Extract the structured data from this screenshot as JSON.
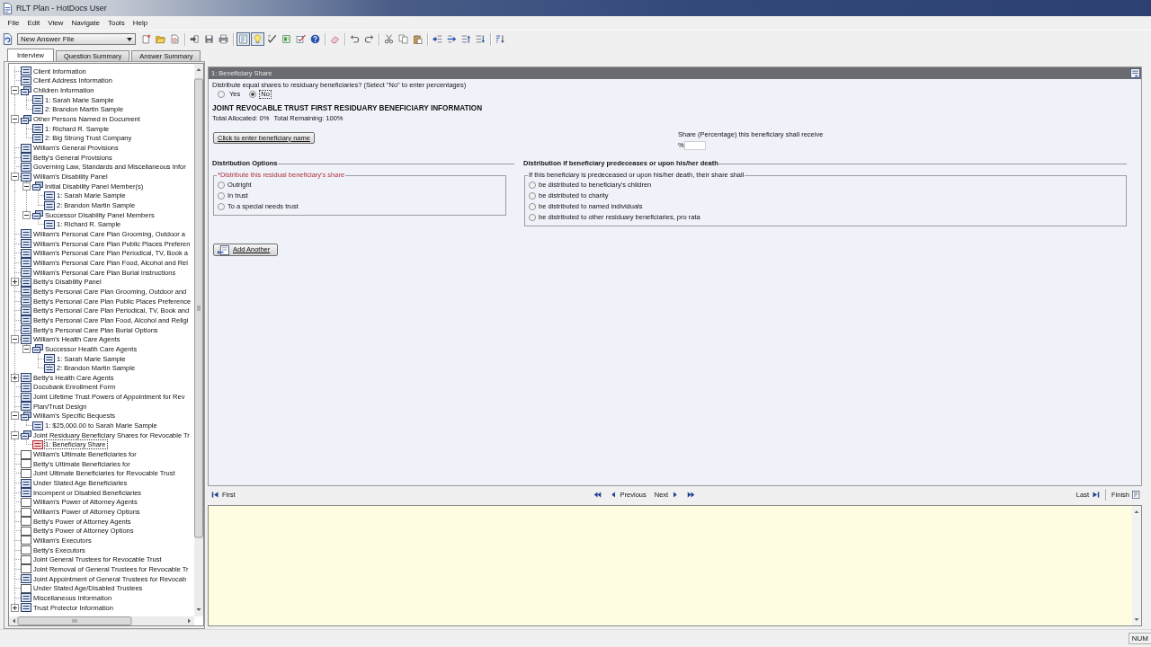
{
  "window": {
    "title": "RLT Plan - HotDocs User"
  },
  "menu": [
    "File",
    "Edit",
    "View",
    "Navigate",
    "Tools",
    "Help"
  ],
  "toolbar": {
    "answer_file": "New Answer File",
    "groups": [
      [
        {
          "kind": "new",
          "pressed": false
        },
        {
          "kind": "open",
          "pressed": false
        },
        {
          "kind": "answer",
          "pressed": false
        }
      ],
      [
        {
          "kind": "send",
          "pressed": false
        },
        {
          "kind": "save",
          "pressed": false
        },
        {
          "kind": "print",
          "pressed": false
        }
      ],
      [
        {
          "kind": "outline",
          "pressed": true
        },
        {
          "kind": "hint",
          "pressed": true
        },
        {
          "kind": "spell",
          "pressed": false
        },
        {
          "kind": "page",
          "pressed": false
        },
        {
          "kind": "checklist",
          "pressed": false
        },
        {
          "kind": "help",
          "pressed": false
        }
      ],
      [
        {
          "kind": "eraser",
          "pressed": false
        }
      ],
      [
        {
          "kind": "undo",
          "pressed": false
        },
        {
          "kind": "redo",
          "pressed": false
        }
      ],
      [
        {
          "kind": "cut",
          "pressed": false
        },
        {
          "kind": "copy",
          "pressed": false
        },
        {
          "kind": "paste",
          "pressed": false
        }
      ],
      [
        {
          "kind": "indent",
          "pressed": false
        },
        {
          "kind": "arrow",
          "pressed": false
        },
        {
          "kind": "up",
          "pressed": false
        },
        {
          "kind": "down",
          "pressed": false
        }
      ],
      [
        {
          "kind": "sort",
          "pressed": false
        }
      ]
    ]
  },
  "tabs": [
    {
      "label": "Interview",
      "selected": true
    },
    {
      "label": "Question Summary",
      "selected": false
    },
    {
      "label": "Answer Summary",
      "selected": false
    }
  ],
  "tree": {
    "items": [
      {
        "label": "Client Information",
        "kind": "dialog",
        "answered": true,
        "selected": false
      },
      {
        "label": "Client Address Information",
        "kind": "dialog",
        "answered": true,
        "selected": false
      },
      {
        "label": "Children Information",
        "kind": "repeat",
        "answered": true,
        "selected": false,
        "expanded": true,
        "children": [
          {
            "label": "1: Sarah Marie Sample",
            "kind": "dialog",
            "answered": true,
            "selected": false
          },
          {
            "label": "2: Brandon Martin Sample",
            "kind": "dialog",
            "answered": true,
            "selected": false
          }
        ]
      },
      {
        "label": "Other Persons Named in Document",
        "kind": "repeat",
        "answered": true,
        "selected": false,
        "expanded": true,
        "children": [
          {
            "label": "1: Richard R. Sample",
            "kind": "dialog",
            "answered": true,
            "selected": false
          },
          {
            "label": "2: Big Strong Trust Company",
            "kind": "dialog",
            "answered": true,
            "selected": false
          }
        ]
      },
      {
        "label": "William's General Provisions",
        "kind": "dialog",
        "answered": true,
        "selected": false
      },
      {
        "label": "Betty's General Provisions",
        "kind": "dialog",
        "answered": true,
        "selected": false
      },
      {
        "label": "Governing Law, Standards and Miscellaneous Infor",
        "kind": "dialog",
        "answered": true,
        "selected": false
      },
      {
        "label": "William's Disability Panel",
        "kind": "dialog",
        "answered": true,
        "selected": false,
        "expanded": true,
        "children": [
          {
            "label": "Initial Disability Panel Member(s)",
            "kind": "repeat",
            "answered": true,
            "selected": false,
            "expanded": true,
            "children": [
              {
                "label": "1: Sarah Marie Sample",
                "kind": "dialog",
                "answered": true,
                "selected": false
              },
              {
                "label": "2: Brandon Martin Sample",
                "kind": "dialog",
                "answered": true,
                "selected": false
              }
            ]
          },
          {
            "label": "Successor Disability Panel Members",
            "kind": "repeat",
            "answered": true,
            "selected": false,
            "expanded": true,
            "children": [
              {
                "label": "1: Richard R. Sample",
                "kind": "dialog",
                "answered": true,
                "selected": false
              }
            ]
          }
        ]
      },
      {
        "label": "William's Personal Care Plan Grooming, Outdoor a",
        "kind": "dialog",
        "answered": true,
        "selected": false
      },
      {
        "label": "William's Personal Care Plan Public Places Preferen",
        "kind": "dialog",
        "answered": true,
        "selected": false
      },
      {
        "label": "William's Personal Care Plan Periodical, TV, Book a",
        "kind": "dialog",
        "answered": true,
        "selected": false
      },
      {
        "label": "William's Personal Care Plan Food, Alcohol and Rel",
        "kind": "dialog",
        "answered": true,
        "selected": false
      },
      {
        "label": "William's Personal Care Plan Burial Instructions",
        "kind": "dialog",
        "answered": true,
        "selected": false
      },
      {
        "label": "Betty's Disability Panel",
        "kind": "dialog",
        "answered": true,
        "selected": false,
        "expanded": false
      },
      {
        "label": "Betty's Personal Care Plan Grooming, Outdoor and",
        "kind": "dialog",
        "answered": true,
        "selected": false
      },
      {
        "label": "Betty's Personal Care Plan Public Places Preference",
        "kind": "dialog",
        "answered": true,
        "selected": false
      },
      {
        "label": "Betty's Personal Care Plan Periodical, TV, Book and",
        "kind": "dialog",
        "answered": true,
        "selected": false
      },
      {
        "label": "Betty's Personal Care Plan Food, Alcohol and Religi",
        "kind": "dialog",
        "answered": true,
        "selected": false
      },
      {
        "label": "Betty's Personal Care Plan Burial Options",
        "kind": "dialog",
        "answered": true,
        "selected": false
      },
      {
        "label": "William's Health Care Agents",
        "kind": "dialog",
        "answered": true,
        "selected": false,
        "expanded": true,
        "children": [
          {
            "label": "Successor Health Care Agents",
            "kind": "repeat",
            "answered": true,
            "selected": false,
            "expanded": true,
            "children": [
              {
                "label": "1: Sarah Marie Sample",
                "kind": "dialog",
                "answered": true,
                "selected": false
              },
              {
                "label": "2: Brandon Martin Sample",
                "kind": "dialog",
                "answered": true,
                "selected": false
              }
            ]
          }
        ]
      },
      {
        "label": "Betty's Health Care Agents",
        "kind": "dialog",
        "answered": true,
        "selected": false,
        "expanded": false
      },
      {
        "label": "Docubank Enrollment Form",
        "kind": "dialog",
        "answered": true,
        "selected": false
      },
      {
        "label": "Joint Lifetime Trust Powers of Appointment for Rev",
        "kind": "dialog",
        "answered": true,
        "selected": false
      },
      {
        "label": "Plan/Trust Design",
        "kind": "dialog",
        "answered": true,
        "selected": false
      },
      {
        "label": "William's Specific Bequests",
        "kind": "repeat",
        "answered": true,
        "selected": false,
        "expanded": true,
        "children": [
          {
            "label": "1: $25,000.00 to Sarah Marie Sample",
            "kind": "dialog",
            "answered": true,
            "selected": false
          }
        ]
      },
      {
        "label": "Joint Residuary Beneficiary Shares for Revocable Tr",
        "kind": "repeat",
        "answered": true,
        "selected": false,
        "expanded": true,
        "children": [
          {
            "label": "1: Beneficiary Share",
            "kind": "dialog",
            "answered": true,
            "selected": true
          }
        ]
      },
      {
        "label": "William's Ultimate Beneficiaries for",
        "kind": "dialog",
        "answered": false,
        "selected": false
      },
      {
        "label": "Betty's Ultimate Beneficiaries for",
        "kind": "dialog",
        "answered": false,
        "selected": false
      },
      {
        "label": "Joint Ultimate Beneficiaries for Revocable Trust",
        "kind": "dialog",
        "answered": false,
        "selected": false
      },
      {
        "label": "Under Stated Age Beneficiaries",
        "kind": "dialog",
        "answered": true,
        "selected": false
      },
      {
        "label": "Incompent or Disabled Beneficiaries",
        "kind": "dialog",
        "answered": true,
        "selected": false
      },
      {
        "label": "William's Power of Attorney Agents",
        "kind": "dialog",
        "answered": false,
        "selected": false
      },
      {
        "label": "William's Power of Attorney Options",
        "kind": "dialog",
        "answered": false,
        "selected": false
      },
      {
        "label": "Betty's Power of Attorney Agents",
        "kind": "dialog",
        "answered": false,
        "selected": false
      },
      {
        "label": "Betty's Power of Attorney Options",
        "kind": "dialog",
        "answered": false,
        "selected": false
      },
      {
        "label": "William's Executors",
        "kind": "dialog",
        "answered": false,
        "selected": false
      },
      {
        "label": "Betty's Executors",
        "kind": "dialog",
        "answered": false,
        "selected": false
      },
      {
        "label": "Joint General Trustees for Revocable Trust",
        "kind": "dialog",
        "answered": false,
        "selected": false
      },
      {
        "label": "Joint Removal of General Trustees for Revocable Tr",
        "kind": "dialog",
        "answered": false,
        "selected": false
      },
      {
        "label": "Joint Appointment of General Trustees for Revocab",
        "kind": "dialog",
        "answered": true,
        "selected": false
      },
      {
        "label": "Under Stated Age/Disabled Trustees",
        "kind": "dialog",
        "answered": false,
        "selected": false
      },
      {
        "label": "Miscellaneous Information",
        "kind": "dialog",
        "answered": true,
        "selected": false
      },
      {
        "label": "Trust Protector Information",
        "kind": "dialog",
        "answered": true,
        "selected": false,
        "expanded": false
      }
    ]
  },
  "form": {
    "header": "1: Beneficiary Share",
    "equal_shares": {
      "question": "Distribute equal shares to residuary beneficiaries? (Select \"No\" to enter percentages)",
      "options": [
        {
          "label": "Yes",
          "selected": false,
          "focused": false
        },
        {
          "label": "No",
          "selected": true,
          "focused": true
        }
      ]
    },
    "heading": "JOINT REVOCABLE TRUST FIRST RESIDUARY BENEFICIARY INFORMATION",
    "totals": [
      "Total Allocated: 0%",
      "Total Remaining: 100%"
    ],
    "name_button": "Click to enter beneficiary name",
    "share": {
      "label": "Share (Percentage) this beneficiary shall receive",
      "unit": "%"
    },
    "sections": [
      {
        "title": "Distribution Options",
        "group": {
          "legend": "*Distribute this residual beneficiary's share",
          "required": true,
          "options": [
            {
              "label": "Outright",
              "selected": false
            },
            {
              "label": "In trust",
              "selected": false
            },
            {
              "label": "To a special needs trust",
              "selected": false
            }
          ]
        }
      },
      {
        "title": "Distribution if beneficiary predeceases or upon his/her death",
        "group": {
          "legend": "If this beneficiary is predeceased or upon his/her death, their share shall",
          "required": false,
          "options": [
            {
              "label": "be distributed to beneficiary's children",
              "selected": false
            },
            {
              "label": "be distributed to charity",
              "selected": false
            },
            {
              "label": "be distributed to named individuals",
              "selected": false
            },
            {
              "label": "be distributed to other residuary beneficiaries, pro rata",
              "selected": false
            }
          ]
        }
      }
    ],
    "add_button": "Add Another"
  },
  "navigation": {
    "first": "First",
    "previous": "Previous",
    "next": "Next",
    "last": "Last",
    "finish": "Finish"
  },
  "status_bar": {
    "indicator": "NUM"
  }
}
